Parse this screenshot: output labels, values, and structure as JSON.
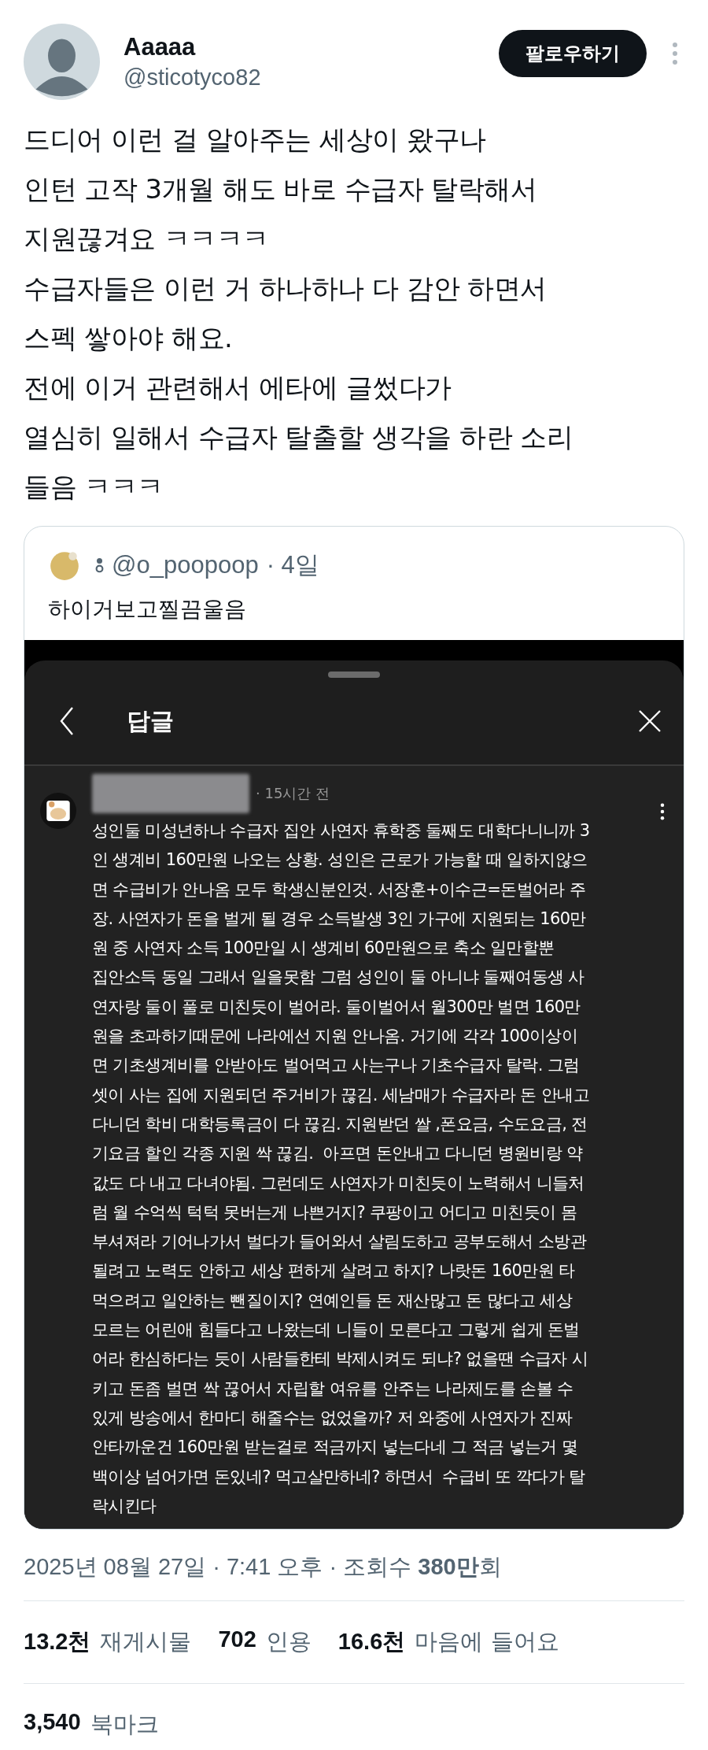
{
  "author": {
    "name": "Aaaaa",
    "handle": "@sticotyco82"
  },
  "follow_button": "팔로우하기",
  "tweet_text": "드디어 이런 걸 알아주는 세상이 왔구나\n인턴 고작 3개월 해도 바로 수급자 탈락해서\n지원끊겨요 ㅋㅋㅋㅋ\n수급자들은 이런 거 하나하나 다 감안 하면서\n스펙 쌓아야 해요.\n전에 이거 관련해서 에타에 글썼다가\n열심히 일해서 수급자 탈출할 생각을 하란 소리\n들음 ㅋㅋㅋ",
  "quote": {
    "handle": "@o_poopoop",
    "time": "· 4일",
    "text": "하이거보고찔끔울음",
    "screenshot": {
      "title": "답글",
      "reply": {
        "time": "· 15시간 전",
        "text": "성인둘 미성년하나 수급자 집안 사연자 휴학중 둘째도 대학다니니까 3\n인 생계비 160만원 나오는 상황. 성인은 근로가 가능할 때 일하지않으\n면 수급비가 안나옴 모두 학생신분인것. 서장훈+이수근=돈벌어라 주\n장. 사연자가 돈을 벌게 될 경우 소득발생 3인 가구에 지원되는 160만\n원 중 사연자 소득 100만일 시 생계비 60만원으로 축소 일만할뿐\n집안소득 동일 그래서 일을못함 그럼 성인이 둘 아니냐 둘째여동생 사\n연자랑 둘이 풀로 미친듯이 벌어라. 둘이벌어서 월300만 벌면 160만\n원을 초과하기때문에 나라에선 지원 안나옴. 거기에 각각 100이상이\n면 기초생계비를 안받아도 벌어먹고 사는구나 기초수급자 탈락. 그럼\n셋이 사는 집에 지원되던 주거비가 끊김. 세남매가 수급자라 돈 안내고\n다니던 학비 대학등록금이 다 끊김. 지원받던 쌀 ,폰요금, 수도요금, 전\n기요금 할인 각종 지원 싹 끊김.  아프면 돈안내고 다니던 병원비랑 약\n값도 다 내고 다녀야됨. 그런데도 사연자가 미친듯이 노력해서 니들처\n럼 월 수억씩 턱턱 못버는게 나쁜거지? 쿠팡이고 어디고 미친듯이 몸\n부셔져라 기어나가서 벌다가 들어와서 살림도하고 공부도해서 소방관\n될려고 노력도 안하고 세상 편하게 살려고 하지? 나랏돈 160만원 타\n먹으려고 일안하는 뺀질이지? 연예인들 돈 재산많고 돈 많다고 세상\n모르는 어린애 힘들다고 나왔는데 니들이 모른다고 그렇게 쉽게 돈벌\n어라 한심하다는 듯이 사람들한테 박제시켜도 되냐? 없을땐 수급자 시\n키고 돈좀 벌면 싹 끊어서 자립할 여유를 안주는 나라제도를 손볼 수\n있게 방송에서 한마디 해줄수는 없었을까? 저 와중에 사연자가 진짜\n안타까운건 160만원 받는걸로 적금까지 넣는다네 그 적금 넣는거 몇\n백이상 넘어가면 돈있네? 먹고살만하네? 하면서  수급비 또 깍다가 탈\n락시킨다"
      }
    }
  },
  "meta": "2025년 08월 27일 · 7:41 오후 · 조회수 **380만**회",
  "stats": [
    {
      "count": "13.2천",
      "label": "재게시물"
    },
    {
      "count": "702",
      "label": "인용"
    },
    {
      "count": "16.6천",
      "label": "마음에 들어요"
    }
  ],
  "bookmarks": {
    "count": "3,540",
    "label": "북마크"
  }
}
